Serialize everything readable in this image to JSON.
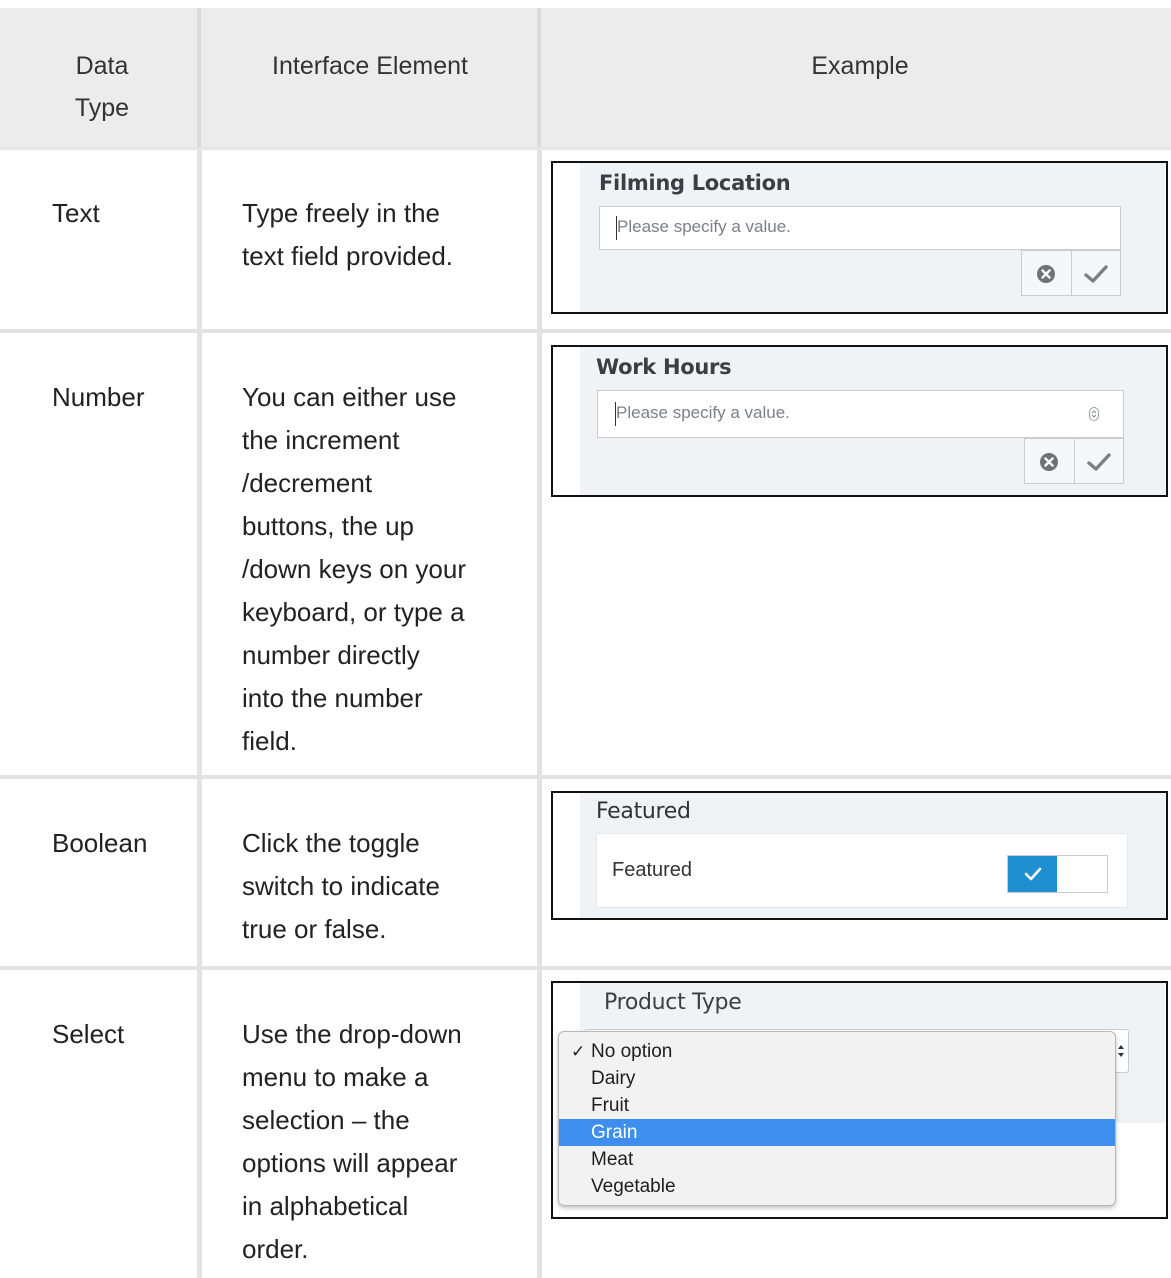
{
  "header": {
    "col1": [
      "Data",
      "Type"
    ],
    "col2": "Interface Element",
    "col3": "Example"
  },
  "rows": [
    {
      "type": "Text",
      "desc": [
        "Type freely in the",
        "text field provided."
      ],
      "example": {
        "label": "Filming Location",
        "placeholder": "Please specify a value."
      }
    },
    {
      "type": "Number",
      "desc": [
        "You can either use",
        "the increment",
        "/decrement",
        "buttons, the up",
        "/down keys on your",
        "keyboard, or type a",
        "number directly",
        "into the number",
        "field."
      ],
      "example": {
        "label": "Work Hours",
        "placeholder": "Please specify a value."
      }
    },
    {
      "type": "Boolean",
      "desc": [
        "Click the toggle",
        "switch to indicate",
        "true or false."
      ],
      "example": {
        "label": "Featured",
        "field_label": "Featured",
        "value": true
      }
    },
    {
      "type": "Select",
      "desc": [
        "Use the drop-down",
        "menu to make a",
        "selection – the",
        "options will appear",
        "in alphabetical",
        "order."
      ],
      "example": {
        "label": "Product Type",
        "options": [
          "No option",
          "Dairy",
          "Fruit",
          "Grain",
          "Meat",
          "Vegetable"
        ],
        "checked_option": "No option",
        "highlighted_option": "Grain"
      }
    }
  ],
  "icons": {
    "clear": "clear-circle-icon",
    "confirm": "checkmark-icon",
    "toggle": "checkmark-icon",
    "spinner": "spinner-updown-icon"
  },
  "colors": {
    "accent": "#1f8fcf",
    "highlight": "#3d8eef"
  }
}
